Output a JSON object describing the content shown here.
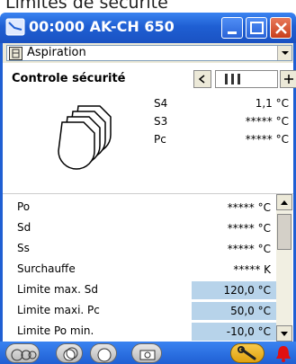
{
  "page_heading": "Limites de sécurité",
  "window": {
    "title": "00:000 AK-CH 650"
  },
  "selector": {
    "value": "Aspiration"
  },
  "section": {
    "title": "Controle sécurité"
  },
  "sensors": [
    {
      "label": "S4",
      "value": "1,1 °C"
    },
    {
      "label": "S3",
      "value": "***** °C"
    },
    {
      "label": "Pc",
      "value": "***** °C"
    }
  ],
  "params": [
    {
      "label": "Po",
      "value": "***** °C",
      "editable": false
    },
    {
      "label": "Sd",
      "value": "***** °C",
      "editable": false
    },
    {
      "label": "Ss",
      "value": "***** °C",
      "editable": false
    },
    {
      "label": "Surchauffe",
      "value": "***** K",
      "editable": false
    },
    {
      "label": "Limite max. Sd",
      "value": "120,0 °C",
      "editable": true
    },
    {
      "label": "Limite maxi. Pc",
      "value": "50,0 °C",
      "editable": true
    },
    {
      "label": "Limite Po min.",
      "value": "-10,0 °C",
      "editable": true
    }
  ],
  "bottom_buttons": [
    "compressors-overview-icon",
    "compressor-group-icon",
    "compressor-icon",
    "camera-icon"
  ],
  "colors": {
    "titlebar": "#1f5fd3",
    "editable_bg": "#b7d3ea",
    "wrench": "#f0b020",
    "alarm": "#e01010"
  }
}
